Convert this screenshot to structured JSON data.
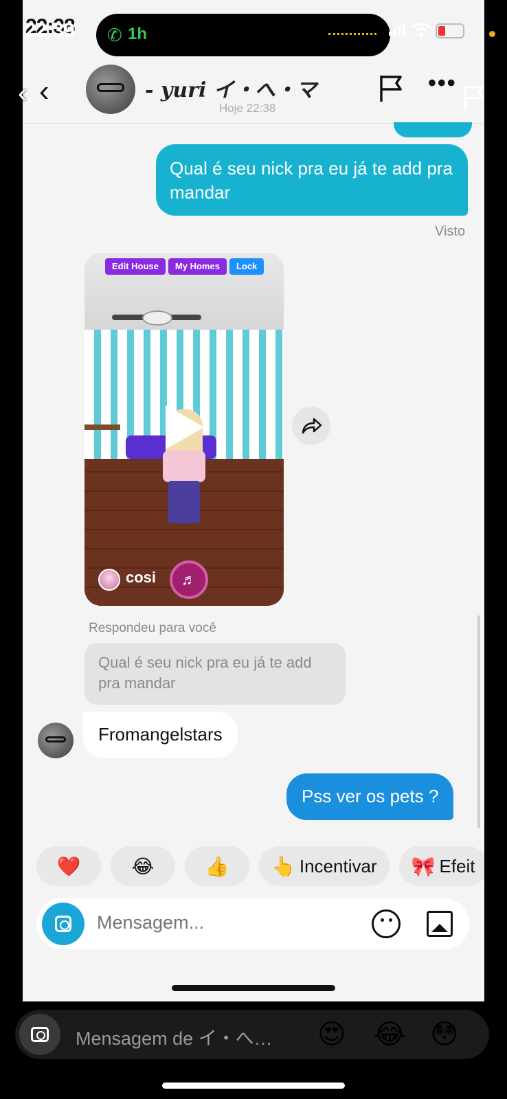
{
  "status_bar": {
    "time": "22:39",
    "inner_time": "22:38",
    "call_duration": "1h"
  },
  "chat_header": {
    "contact_name": "- yuri イ・へ・マ",
    "status": "Hoje 22:38"
  },
  "messages": {
    "outgoing_1": "Qual é seu nick pra eu já te add pra mandar",
    "seen_label": "Visto",
    "reel": {
      "buttons": [
        "Edit House",
        "My Homes",
        "Lock"
      ],
      "author": "cosi"
    },
    "reply_label": "Respondeu para você",
    "reply_quote": "Qual é seu nick pra eu já te add pra mandar",
    "incoming_1": "Fromangelstars",
    "outgoing_2": "Pss ver os pets ?"
  },
  "quick_reactions": [
    {
      "emoji": "❤️",
      "label": ""
    },
    {
      "emoji": "😂",
      "label": ""
    },
    {
      "emoji": "👍",
      "label": ""
    },
    {
      "emoji": "👆",
      "label": "Incentivar"
    },
    {
      "emoji": "🎀",
      "label": "Efeit"
    }
  ],
  "composer": {
    "placeholder": "Mensagem..."
  },
  "story_reply": {
    "placeholder": "Mensagem de イ・へ…",
    "emojis": [
      "😍",
      "😂",
      "😳"
    ]
  },
  "colors": {
    "outgoing_bubble": "#16b2d0",
    "outgoing_bubble_2": "#1a8fdd",
    "call_green": "#34c759"
  }
}
